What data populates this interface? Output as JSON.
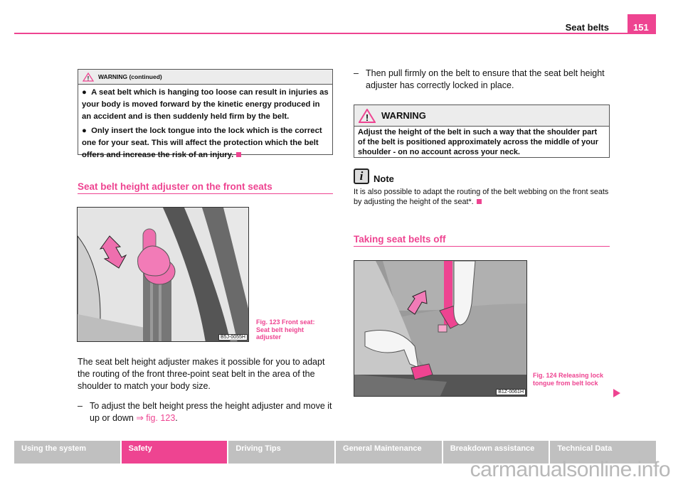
{
  "header": {
    "section": "Seat belts",
    "page": "151"
  },
  "left": {
    "warning_cont": {
      "title": "WARNING (continued)",
      "items": [
        "A seat belt which is hanging too loose can result in injuries as your body is moved forward by the kinetic energy produced in an accident and is then suddenly held firm by the belt.",
        "Only insert the lock tongue into the lock which is the correct one for your seat. This will affect the protection which the belt offers and increase the risk of an injury."
      ]
    },
    "heading": "Seat belt height adjuster on the front seats",
    "figure": {
      "code": "B5J-0055H",
      "caption": "Fig. 123   Front seat: Seat belt height adjuster"
    },
    "paragraph": "The seat belt height adjuster makes it possible for you to adapt the routing of the front three-point seat belt in the area of the shoulder to match your body size.",
    "step": {
      "dash": "–",
      "text": "To adjust the belt height press the height adjuster and move it up or down ",
      "ref": "⇒ fig. 123",
      "end": "."
    }
  },
  "right": {
    "step": {
      "dash": "–",
      "text": "Then pull firmly on the belt to ensure that the seat belt height adjuster has correctly locked in place."
    },
    "warning": {
      "title": "WARNING",
      "text": "Adjust the height of the belt in such a way that the shoulder part of the belt is positioned approximately across the middle of your shoulder - on no account across your neck."
    },
    "note": {
      "title": "Note",
      "text": "It is also possible to adapt the routing of the belt webbing on the front seats by adjusting the height of the seat*."
    },
    "heading": "Taking seat belts off",
    "figure": {
      "code": "B1Z-0061H",
      "caption": "Fig. 124   Releasing lock tongue from belt lock"
    }
  },
  "footer": {
    "tabs": [
      {
        "label": "Using the system"
      },
      {
        "label": "Safety",
        "active": true
      },
      {
        "label": "Driving Tips"
      },
      {
        "label": "General Maintenance"
      },
      {
        "label": "Breakdown assistance"
      },
      {
        "label": "Technical Data"
      }
    ]
  },
  "watermark": "carmanualsonline.info",
  "colors": {
    "accent": "#ee4491",
    "tab_gray": "#c0c0c0"
  }
}
